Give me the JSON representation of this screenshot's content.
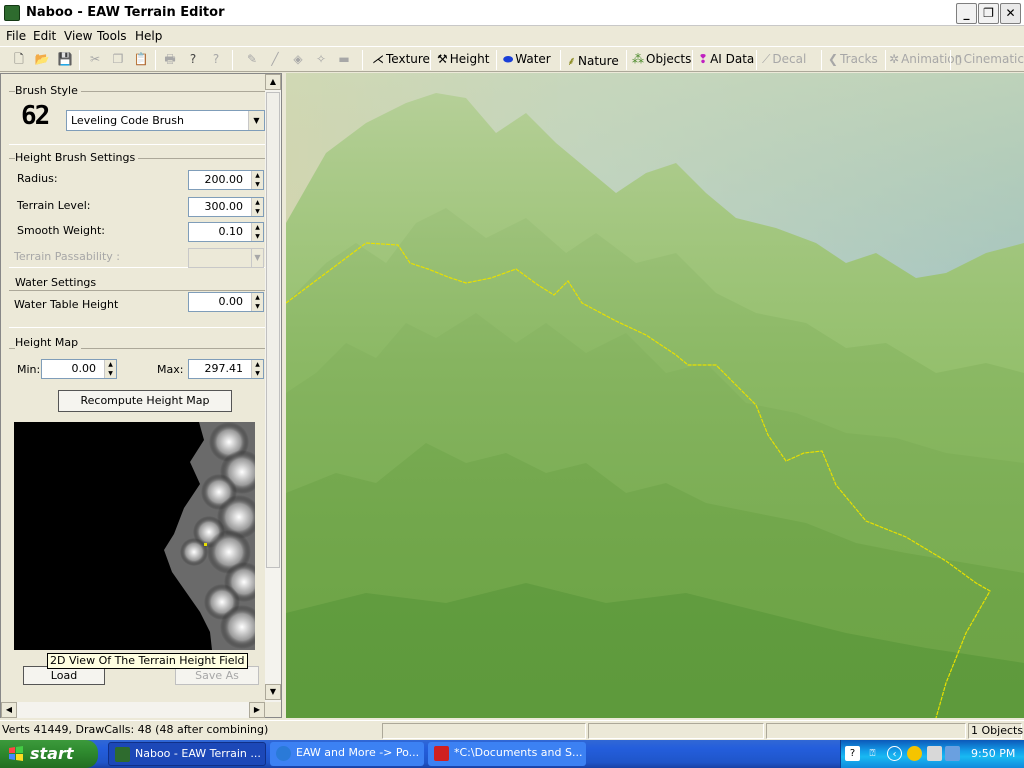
{
  "window": {
    "title": "Naboo - EAW Terrain Editor"
  },
  "menu": [
    "File",
    "Edit",
    "View",
    "Tools",
    "Help"
  ],
  "toolbar": {
    "modes": [
      {
        "label": "Texture",
        "enabled": true
      },
      {
        "label": "Height",
        "enabled": true
      },
      {
        "label": "Water",
        "enabled": true
      },
      {
        "label": "Nature",
        "enabled": true
      },
      {
        "label": "Objects",
        "enabled": true
      },
      {
        "label": "AI Data",
        "enabled": true
      },
      {
        "label": "Decal",
        "enabled": false
      },
      {
        "label": "Tracks",
        "enabled": false
      },
      {
        "label": "Animation",
        "enabled": false
      },
      {
        "label": "Cinematic",
        "enabled": false
      }
    ]
  },
  "panel": {
    "brush_style": {
      "title": "Brush Style",
      "glyph": "62",
      "selected": "Leveling Code Brush"
    },
    "height_brush": {
      "title": "Height Brush Settings",
      "radius_label": "Radius:",
      "radius_value": "200.00",
      "terrain_level_label": "Terrain Level:",
      "terrain_level_value": "300.00",
      "smooth_weight_label": "Smooth Weight:",
      "smooth_weight_value": "0.10",
      "passability_label": "Terrain Passability :",
      "passability_value": ""
    },
    "water": {
      "title": "Water Settings",
      "table_height_label": "Water Table Height",
      "table_height_value": "0.00"
    },
    "height_map": {
      "title": "Height Map",
      "min_label": "Min:",
      "min_value": "0.00",
      "max_label": "Max:",
      "max_value": "297.41",
      "recompute_label": "Recompute Height Map",
      "tooltip": "2D View Of The Terrain Height Field",
      "load_label": "Load",
      "save_as_label": "Save As"
    }
  },
  "status": {
    "stats": "Verts 41449, DrawCalls: 48 (48 after combining)",
    "objects": "1 Objects"
  },
  "taskbar": {
    "start": "start",
    "tasks": [
      {
        "label": "Naboo - EAW Terrain ...",
        "active": true
      },
      {
        "label": "EAW and More -> Po...",
        "active": false
      },
      {
        "label": "*C:\\Documents and S...",
        "active": false
      }
    ],
    "clock": "9:50 PM"
  },
  "colors": {
    "terrain_green": "#6fa64a",
    "sky": "#a8c6dc",
    "xp_blue": "#245edc",
    "boundary_line": "#e8e000"
  }
}
